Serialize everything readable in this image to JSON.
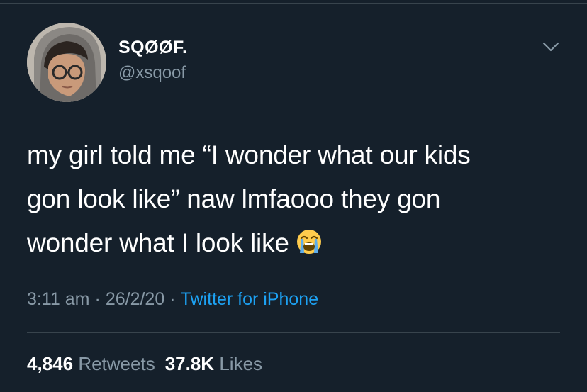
{
  "user": {
    "display_name": "SQØØF.",
    "handle": "@xsqoof"
  },
  "tweet": {
    "line1": "my girl told me “I wonder what our kids",
    "line2": "gon look like” naw lmfaooo they gon",
    "line3": "wonder what I look like",
    "emoji_icon": "loudly-crying-face-icon"
  },
  "meta": {
    "time": "3:11 am",
    "separator": "·",
    "date": "26/2/20",
    "source": "Twitter for iPhone"
  },
  "stats": {
    "retweets_count": "4,846",
    "retweets_label": "Retweets",
    "likes_count": "37.8K",
    "likes_label": "Likes"
  },
  "colors": {
    "background": "#15202b",
    "secondary_text": "#8899a6",
    "link": "#1da1f2",
    "divider": "#38444d"
  }
}
